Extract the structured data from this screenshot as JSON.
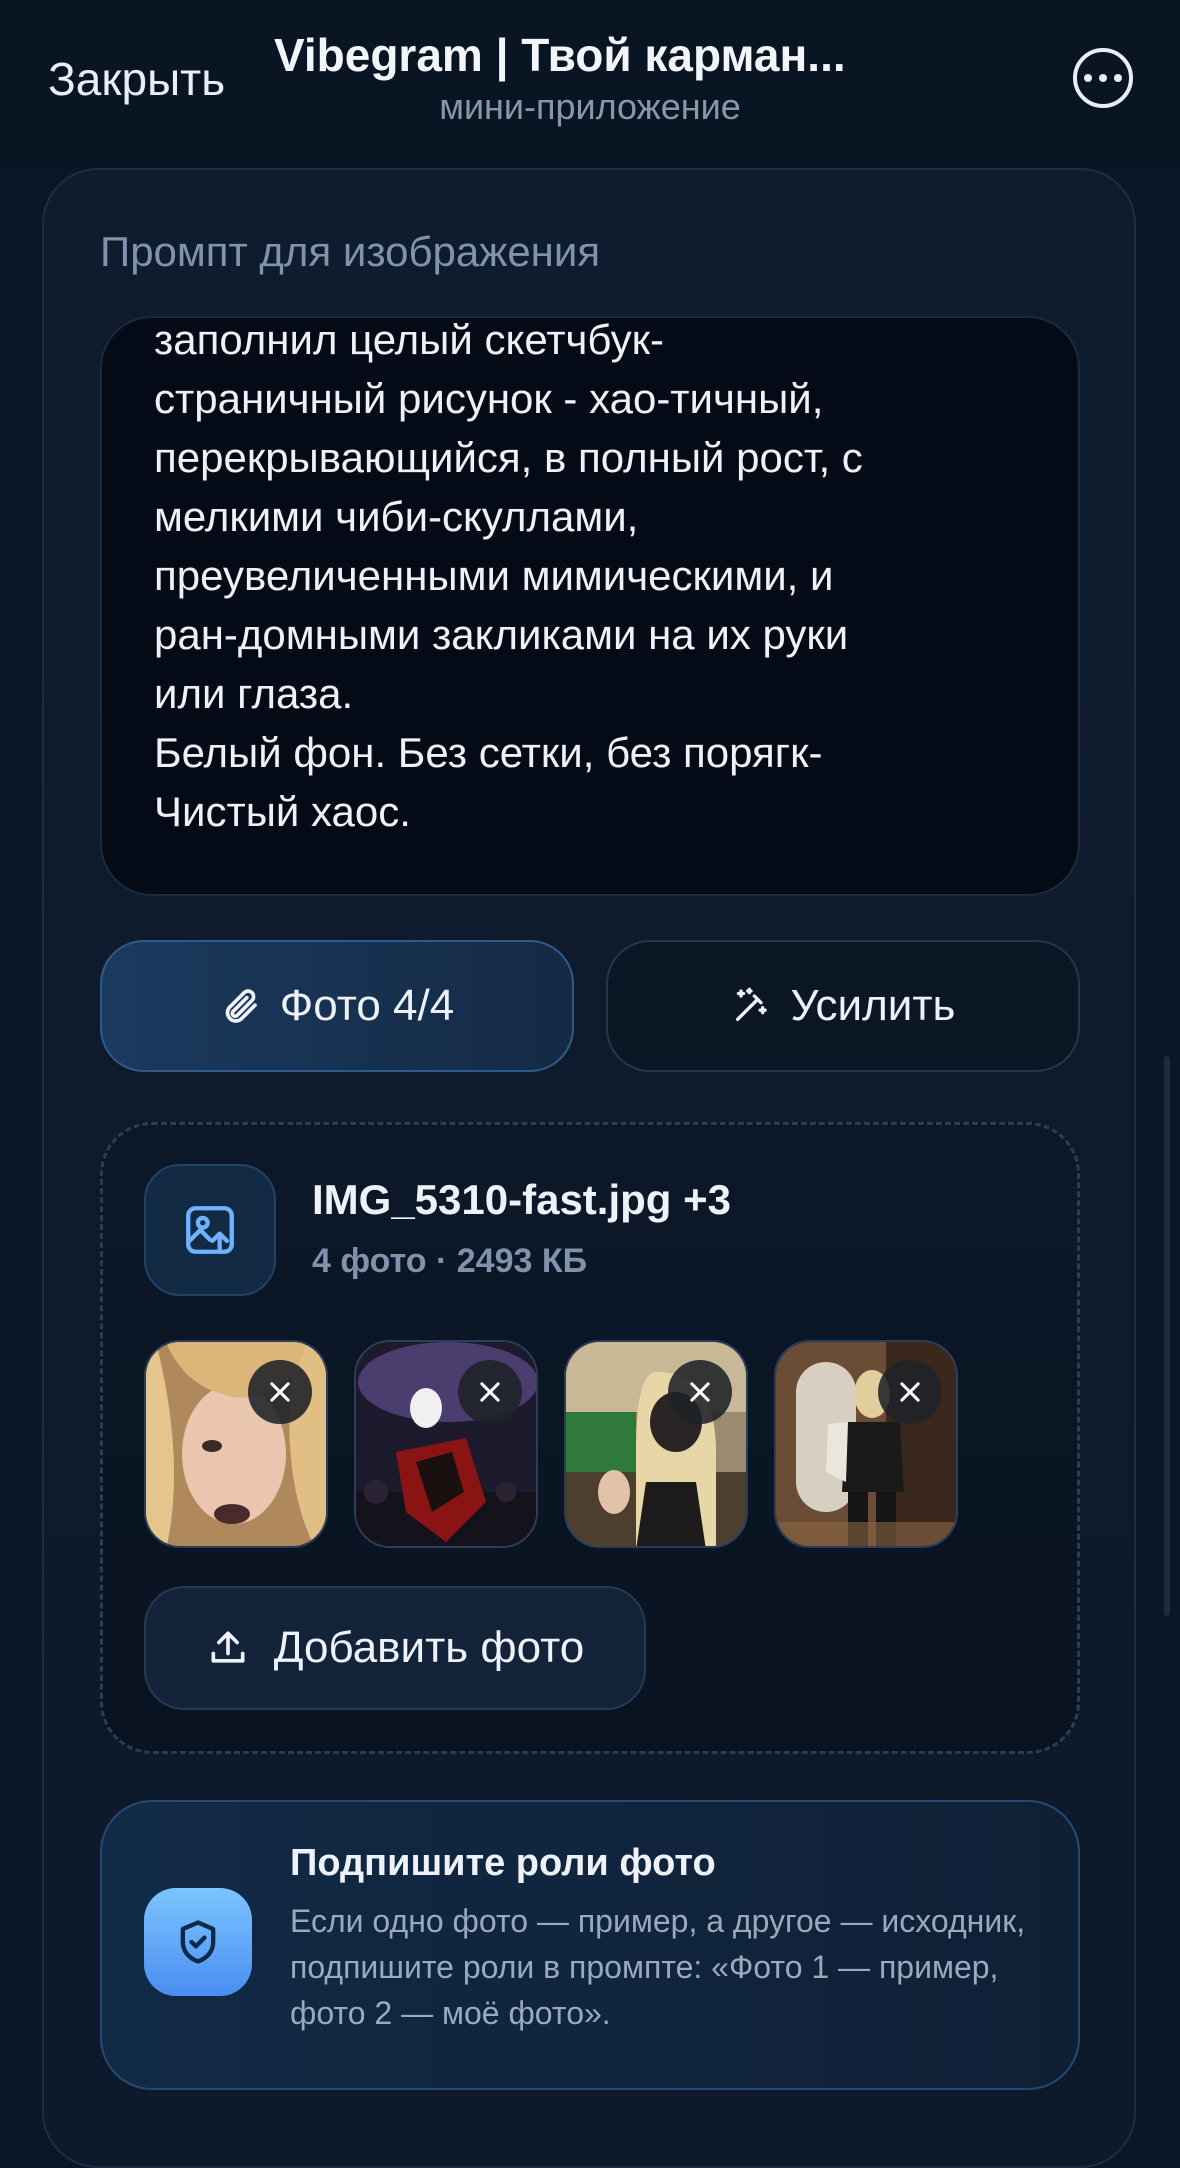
{
  "header": {
    "close_label": "Закрыть",
    "title": "Vibegram | Твой карман...",
    "subtitle": "мини-приложение",
    "more_icon": "more-icon"
  },
  "prompt": {
    "label": "Промпт для изображения",
    "text": "заполнил целый скетчбук-\nстраничный рисунок - хао-тичный,\nперекрывающийся, в полный рост, с\nмелкими чиби-скуллами,\nпреувеличенными мимическими, и\nран-домными закликами на их руки\nили глаза.\nБелый фон. Без сетки, без порягк-\nЧистый хаос."
  },
  "actions": {
    "photo_label": "Фото 4/4",
    "photo_icon": "paperclip-icon",
    "enhance_label": "Усилить",
    "enhance_icon": "magic-wand-icon"
  },
  "upload": {
    "file_name": "IMG_5310-fast.jpg +3",
    "file_meta": "4 фото · 2493 КБ",
    "file_icon": "image-upload-icon",
    "add_label": "Добавить фото",
    "add_icon": "upload-icon",
    "thumbnails": [
      {
        "name": "photo-1"
      },
      {
        "name": "photo-2"
      },
      {
        "name": "photo-3"
      },
      {
        "name": "photo-4"
      }
    ]
  },
  "hint": {
    "title": "Подпишите роли фото",
    "text": "Если одно фото — пример, а другое — исходник, подпишите роли в промпте: «Фото 1 — пример, фото 2 — моё фото».",
    "icon": "shield-check-icon"
  },
  "colors": {
    "background": "#0b1626",
    "accent": "#4a8ef0",
    "card": "#0f1c2e"
  }
}
